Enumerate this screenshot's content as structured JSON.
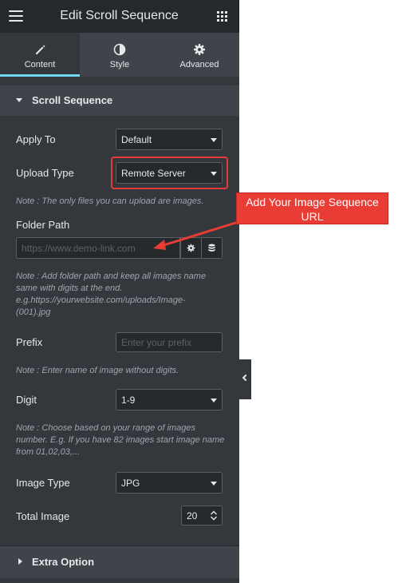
{
  "header": {
    "title": "Edit Scroll Sequence",
    "menu_icon": "hamburger-icon",
    "grid_icon": "grid-icon"
  },
  "tabs": [
    {
      "label": "Content",
      "icon": "pencil-icon",
      "active": true
    },
    {
      "label": "Style",
      "icon": "half-circle-icon",
      "active": false
    },
    {
      "label": "Advanced",
      "icon": "gear-icon",
      "active": false
    }
  ],
  "section": {
    "title": "Scroll Sequence",
    "expanded": true
  },
  "controls": {
    "apply_to": {
      "label": "Apply To",
      "value": "Default"
    },
    "upload_type": {
      "label": "Upload Type",
      "value": "Remote Server"
    },
    "upload_note": "Note : The only files you can upload are images.",
    "folder_path": {
      "label": "Folder Path",
      "placeholder": "https://www.demo-link.com"
    },
    "folder_note": "Note : Add folder path and keep all images name same with digits at the end. e.g.https://yourwebsite.com/uploads/Image-(001).jpg",
    "prefix": {
      "label": "Prefix",
      "placeholder": "Enter your prefix"
    },
    "prefix_note": "Note : Enter name of image without digits.",
    "digit": {
      "label": "Digit",
      "value": "1-9"
    },
    "digit_note": "Note : Choose based on your range of images number. E.g. If you have 82 images start image name from 01,02,03,...",
    "image_type": {
      "label": "Image Type",
      "value": "JPG"
    },
    "total_image": {
      "label": "Total Image",
      "value": "20"
    }
  },
  "extra_section": {
    "title": "Extra Option",
    "expanded": false
  },
  "callout": {
    "text": "Add Your Image Sequence URL"
  },
  "colors": {
    "panel_bg": "#34383c",
    "header_bg": "#26292c",
    "tab_accent": "#71d7f7",
    "callout_red": "#e93c35",
    "highlight_red": "#e53935"
  }
}
